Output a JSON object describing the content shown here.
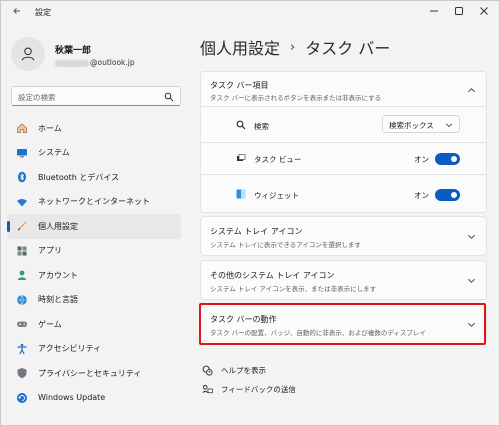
{
  "app": {
    "title": "設定"
  },
  "profile": {
    "name": "秋葉一郎",
    "email_suffix": "@outlook.jp"
  },
  "search": {
    "placeholder": "設定の検索"
  },
  "sidebar": {
    "items": [
      {
        "label": "ホーム",
        "icon": "home-icon",
        "active": false
      },
      {
        "label": "システム",
        "icon": "monitor-icon",
        "active": false
      },
      {
        "label": "Bluetooth とデバイス",
        "icon": "bluetooth-icon",
        "active": false
      },
      {
        "label": "ネットワークとインターネット",
        "icon": "wifi-icon",
        "active": false
      },
      {
        "label": "個人用設定",
        "icon": "brush-icon",
        "active": true
      },
      {
        "label": "アプリ",
        "icon": "apps-icon",
        "active": false
      },
      {
        "label": "アカウント",
        "icon": "account-icon",
        "active": false
      },
      {
        "label": "時刻と言語",
        "icon": "globe-clock-icon",
        "active": false
      },
      {
        "label": "ゲーム",
        "icon": "gamepad-icon",
        "active": false
      },
      {
        "label": "アクセシビリティ",
        "icon": "accessibility-icon",
        "active": false
      },
      {
        "label": "プライバシーとセキュリティ",
        "icon": "shield-icon",
        "active": false
      },
      {
        "label": "Windows Update",
        "icon": "update-icon",
        "active": false
      }
    ]
  },
  "breadcrumb": {
    "parent": "個人用設定",
    "separator": "›",
    "current": "タスク バー"
  },
  "sections": {
    "taskbar_items": {
      "title": "タスク バー項目",
      "subtitle": "タスク バーに表示されるボタンを表示または非表示にする",
      "rows": {
        "search": {
          "label": "検索",
          "value": "検索ボックス"
        },
        "task_view": {
          "label": "タスク ビュー",
          "state": "オン",
          "on": true
        },
        "widgets": {
          "label": "ウィジェット",
          "state": "オン",
          "on": true
        }
      }
    },
    "system_tray": {
      "title": "システム トレイ アイコン",
      "subtitle": "システム トレイに表示できるアイコンを選択します"
    },
    "other_tray": {
      "title": "その他のシステム トレイ アイコン",
      "subtitle": "システム トレイ アイコンを表示、または非表示にします"
    },
    "behaviors": {
      "title": "タスク バーの動作",
      "subtitle": "タスク バーの配置、バッジ、自動的に非表示、および複数のディスプレイ"
    }
  },
  "links": {
    "help": "ヘルプを表示",
    "feedback": "フィードバックの送信"
  },
  "colors": {
    "accent": "#0a5cc2",
    "highlight": "#e0141a",
    "background": "#f3f3f3"
  }
}
